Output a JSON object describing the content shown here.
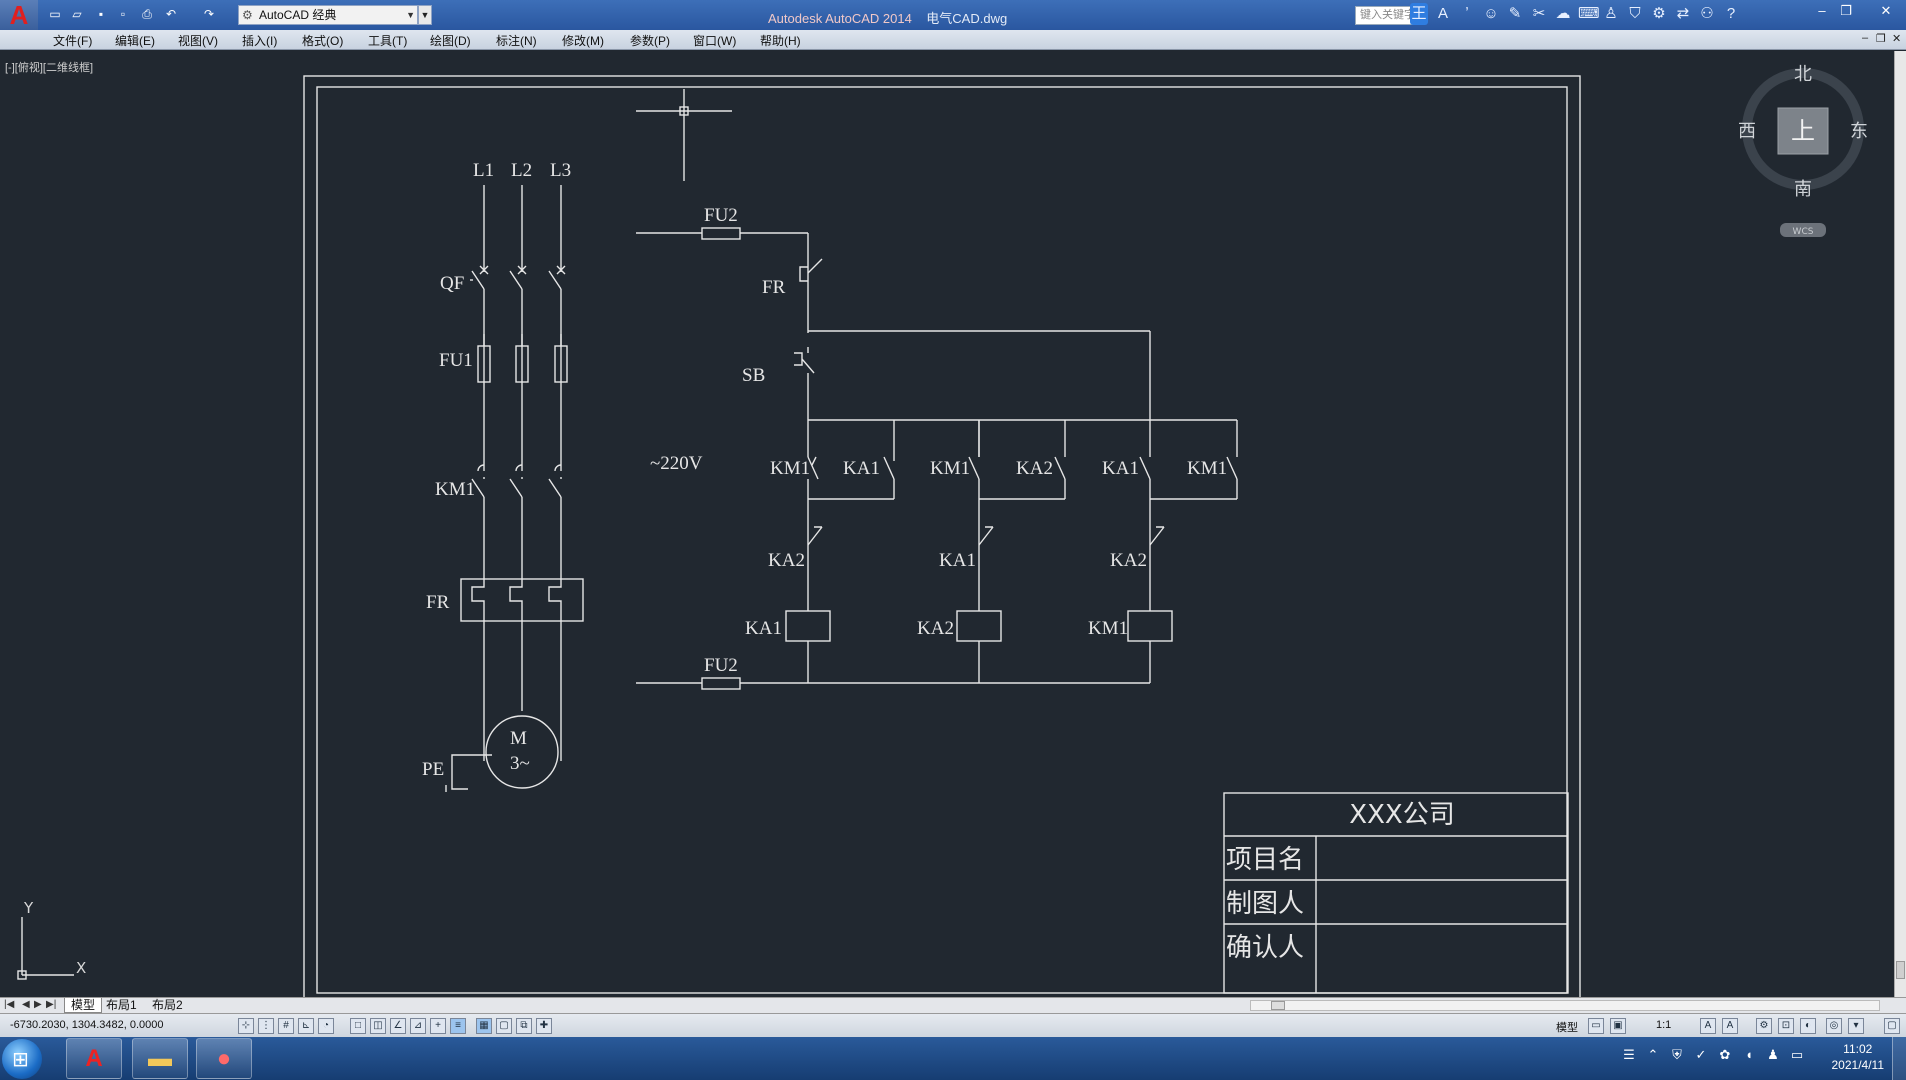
{
  "titlebar": {
    "workspace": "AutoCAD 经典",
    "app_name": "Autodesk AutoCAD 2014",
    "file_name": "电气CAD.dwg",
    "search_placeholder": "键入关键字"
  },
  "menu": [
    "文件(F)",
    "编辑(E)",
    "视图(V)",
    "插入(I)",
    "格式(O)",
    "工具(T)",
    "绘图(D)",
    "标注(N)",
    "修改(M)",
    "参数(P)",
    "窗口(W)",
    "帮助(H)"
  ],
  "viewport": {
    "label": "[-][俯视][二维线框]"
  },
  "viewcube": {
    "north": "北",
    "south": "南",
    "east": "东",
    "west": "西",
    "face": "上",
    "wcs": "WCS"
  },
  "ucs": {
    "x": "X",
    "y": "Y"
  },
  "schematic": {
    "phases": [
      "L1",
      "L2",
      "L3"
    ],
    "qf": "QF",
    "fu1": "FU1",
    "km1": "KM1",
    "fr": "FR",
    "pe": "PE",
    "motor_m": "M",
    "motor_3": "3~",
    "fu2_top": "FU2",
    "fu2_bottom": "FU2",
    "fr_contact": "FR",
    "sb": "SB",
    "voltage": "~220V",
    "row1": [
      "KM1",
      "KA1",
      "KM1",
      "KA2",
      "KA1",
      "KM1"
    ],
    "row2": [
      "KA2",
      "KA1",
      "KA2"
    ],
    "coils": [
      "KA1",
      "KA2",
      "KM1"
    ]
  },
  "title_block": {
    "company": "XXX公司",
    "rows": [
      "项目名",
      "制图人",
      "确认人"
    ]
  },
  "tabs": [
    "模型",
    "布局1",
    "布局2"
  ],
  "status": {
    "coords": "-6730.2030, 1304.3482, 0.0000",
    "model": "模型",
    "scale": "1:1"
  },
  "taskbar": {
    "time": "11:02",
    "date": "2021/4/11"
  },
  "colors": {
    "background": "#212830",
    "line": "#e6e6e6"
  }
}
